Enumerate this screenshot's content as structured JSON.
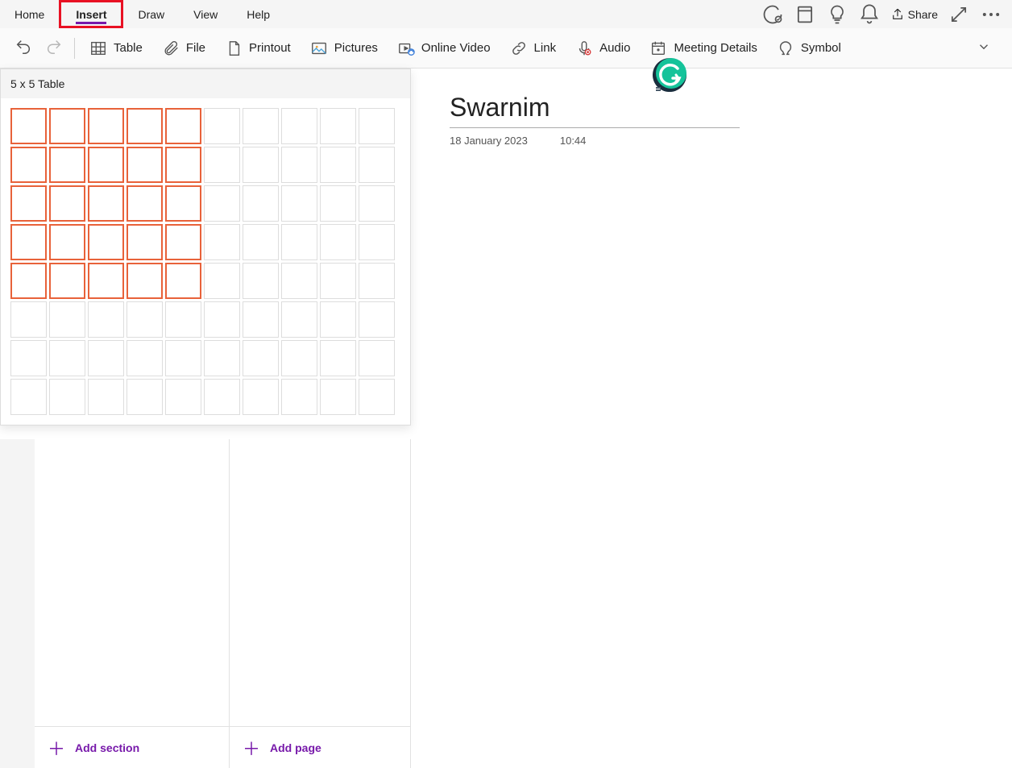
{
  "menu": {
    "tabs": [
      "Home",
      "Insert",
      "Draw",
      "View",
      "Help"
    ],
    "active_index": 1,
    "highlighted_index": 1,
    "share_label": "Share"
  },
  "ribbon": {
    "items": [
      {
        "label": "Table",
        "icon": "table-icon"
      },
      {
        "label": "File",
        "icon": "paperclip-icon"
      },
      {
        "label": "Printout",
        "icon": "printout-icon"
      },
      {
        "label": "Pictures",
        "icon": "pictures-icon"
      },
      {
        "label": "Online Video",
        "icon": "online-video-icon"
      },
      {
        "label": "Link",
        "icon": "link-icon"
      },
      {
        "label": "Audio",
        "icon": "audio-icon"
      },
      {
        "label": "Meeting Details",
        "icon": "meeting-icon"
      },
      {
        "label": "Symbol",
        "icon": "symbol-icon"
      }
    ]
  },
  "table_picker": {
    "header": "5 x 5 Table",
    "rows": 8,
    "cols": 10,
    "selected_rows": 5,
    "selected_cols": 5
  },
  "page": {
    "title": "Swarnim",
    "date": "18 January 2023",
    "time": "10:44"
  },
  "footer": {
    "add_section": "Add section",
    "add_page": "Add page"
  }
}
